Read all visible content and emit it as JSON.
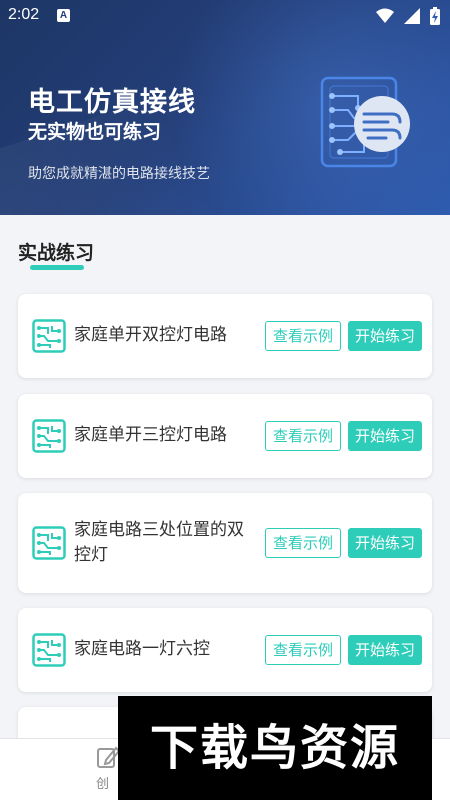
{
  "status_bar": {
    "time": "2:02",
    "notification_letter": "A"
  },
  "hero": {
    "title": "电工仿真接线",
    "subtitle": "无实物也可练习",
    "description": "助您成就精湛的电路接线技艺"
  },
  "section": {
    "title": "实战练习"
  },
  "practice_items": [
    {
      "title": "家庭单开双控灯电路",
      "example_label": "查看示例",
      "start_label": "开始练习"
    },
    {
      "title": "家庭单开三控灯电路",
      "example_label": "查看示例",
      "start_label": "开始练习"
    },
    {
      "title": "家庭电路三处位置的双控灯",
      "example_label": "查看示例",
      "start_label": "开始练习"
    },
    {
      "title": "家庭电路一灯六控",
      "example_label": "查看示例",
      "start_label": "开始练习"
    }
  ],
  "bottom_nav": {
    "create_label": "创"
  },
  "watermark": {
    "text": "下载鸟资源"
  },
  "colors": {
    "accent": "#2ecdb9",
    "hero_dark": "#1d3665",
    "hero_light": "#2f5cb0"
  }
}
